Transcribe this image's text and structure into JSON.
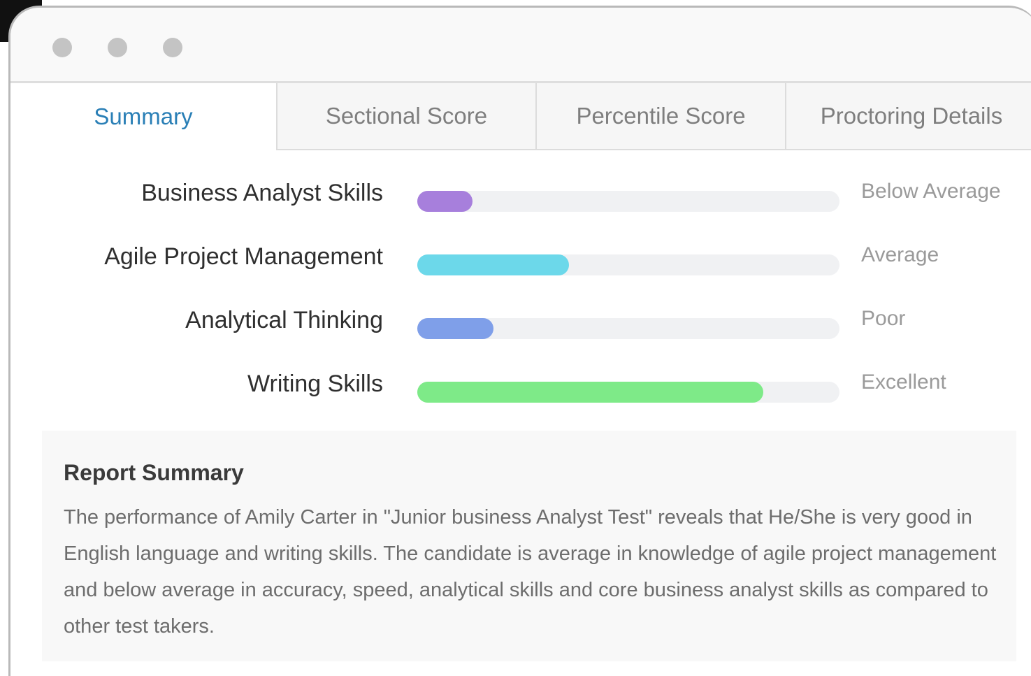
{
  "tabs": [
    {
      "label": "Summary",
      "active": true
    },
    {
      "label": "Sectional Score",
      "active": false
    },
    {
      "label": "Percentile Score",
      "active": false
    },
    {
      "label": "Proctoring Details",
      "active": false
    }
  ],
  "skills": [
    {
      "label": "Business Analyst Skills",
      "level": "Below Average",
      "fraction": 0.13,
      "color": "#a77fdc"
    },
    {
      "label": "Agile Project Management",
      "level": "Average",
      "fraction": 0.36,
      "color": "#6cd8ea"
    },
    {
      "label": "Analytical Thinking",
      "level": "Poor",
      "fraction": 0.18,
      "color": "#7f9fe9"
    },
    {
      "label": "Writing Skills",
      "level": "Excellent",
      "fraction": 0.82,
      "color": "#7eea88"
    }
  ],
  "report": {
    "title": "Report Summary",
    "text": "The performance of Amily Carter in \"Junior business Analyst Test\" reveals that He/She is very good in English language and writing skills. The candidate is average in knowledge of agile project management and below average in accuracy, speed, analytical skills and core business analyst skills as compared to other test takers."
  }
}
